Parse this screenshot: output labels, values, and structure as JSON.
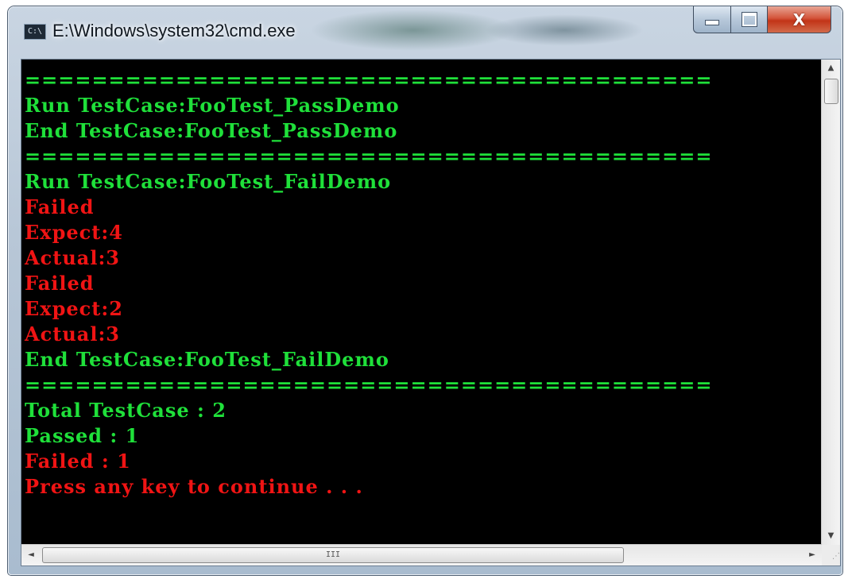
{
  "window": {
    "title": "E:\\Windows\\system32\\cmd.exe",
    "app_icon_text": "C:\\",
    "buttons": {
      "minimize_icon": "minimize-icon",
      "maximize_icon": "maximize-icon",
      "close_icon": "close-icon",
      "close_glyph": "X"
    }
  },
  "console": {
    "colors": {
      "green": "#1fe03a",
      "red": "#f01414",
      "background": "#000000"
    },
    "lines": [
      {
        "text": "=========================================",
        "color": "green"
      },
      {
        "text": "Run TestCase:FooTest_PassDemo",
        "color": "green"
      },
      {
        "text": "End TestCase:FooTest_PassDemo",
        "color": "green"
      },
      {
        "text": "=========================================",
        "color": "green"
      },
      {
        "text": "Run TestCase:FooTest_FailDemo",
        "color": "green"
      },
      {
        "text": "Failed",
        "color": "red"
      },
      {
        "text": "Expect:4",
        "color": "red"
      },
      {
        "text": "Actual:3",
        "color": "red"
      },
      {
        "text": "Failed",
        "color": "red"
      },
      {
        "text": "Expect:2",
        "color": "red"
      },
      {
        "text": "Actual:3",
        "color": "red"
      },
      {
        "text": "End TestCase:FooTest_FailDemo",
        "color": "green"
      },
      {
        "text": "=========================================",
        "color": "green"
      },
      {
        "text": "Total TestCase : 2",
        "color": "green"
      },
      {
        "text": "Passed : 1",
        "color": "green"
      },
      {
        "text": "Failed : 1",
        "color": "red"
      },
      {
        "text": "Press any key to continue . . .",
        "color": "red"
      }
    ]
  },
  "scrollbars": {
    "vertical": {
      "up_icon": "arrow-up-icon",
      "down_icon": "arrow-down-icon",
      "up_glyph": "▲",
      "down_glyph": "▼"
    },
    "horizontal": {
      "left_icon": "arrow-left-icon",
      "right_icon": "arrow-right-icon",
      "left_glyph": "◄",
      "right_glyph": "►",
      "grip_glyph": "III"
    }
  }
}
